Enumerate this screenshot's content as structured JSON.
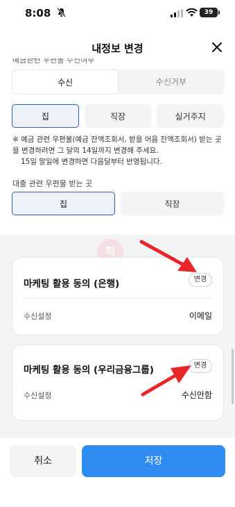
{
  "status": {
    "time": "8:08",
    "battery": "39"
  },
  "header": {
    "title": "내정보 변경"
  },
  "cut_label": "예금관련 우편물 수신여부",
  "receive": {
    "options": [
      "수신",
      "수신거부"
    ],
    "selected": "수신"
  },
  "deposit_mail": {
    "options": [
      "집",
      "직장",
      "실거주지"
    ],
    "selected": "집"
  },
  "note": {
    "line1": "※ 예금 관련 우편물(예금 잔액조회서, 받을 어음 잔액조회서) 받는 곳을 변경하려면 그 달의 14일까지 변경해 주세요.",
    "line2": "15일 말일에 변경하면 다음달부터 반영됩니다."
  },
  "loan_mail": {
    "label": "대출 관련 우편물 받는 곳",
    "options": [
      "집",
      "직장"
    ],
    "selected": "집"
  },
  "marketing_bank": {
    "title": "마케팅 활용 동의 (은행)",
    "change_label": "변경",
    "row_label": "수신설정",
    "row_value": "이메일"
  },
  "marketing_group": {
    "title": "마케팅 활용 동의 (우리금융그룹)",
    "change_label": "변경",
    "row_label": "수신설정",
    "row_value": "수신안함"
  },
  "watermark": "픽",
  "footer": {
    "cancel_label": "취소",
    "save_label": "저장"
  },
  "colors": {
    "accent": "#2f8cf0",
    "selected_border": "#2f5ea8",
    "arrow": "#e8262a"
  }
}
